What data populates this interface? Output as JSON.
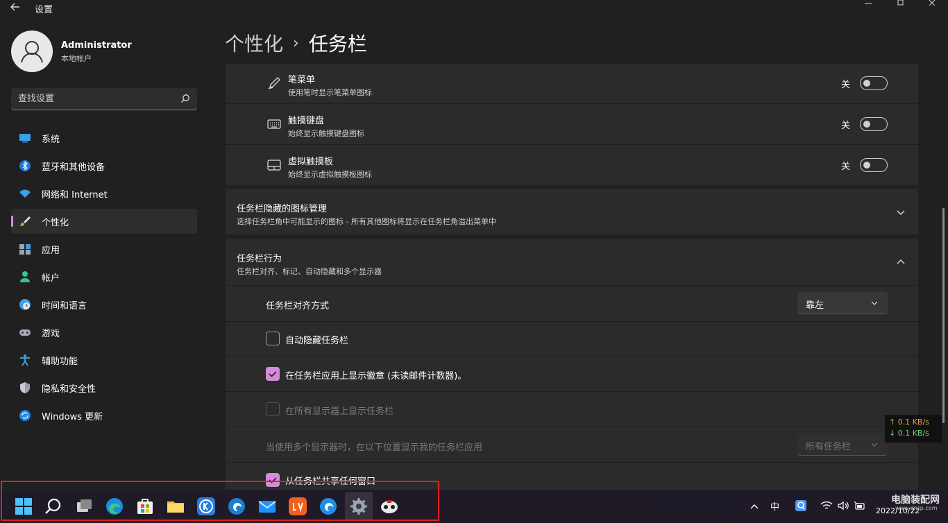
{
  "titlebar": {
    "back_icon": "arrow-left-icon",
    "title": "设置"
  },
  "user": {
    "name": "Administrator",
    "type": "本地帐户"
  },
  "search": {
    "placeholder": "查找设置"
  },
  "sidebar": {
    "items": [
      {
        "label": "系统",
        "icon": "monitor-icon",
        "active": false
      },
      {
        "label": "蓝牙和其他设备",
        "icon": "bluetooth-icon",
        "active": false
      },
      {
        "label": "网络和 Internet",
        "icon": "wifi-icon",
        "active": false
      },
      {
        "label": "个性化",
        "icon": "brush-icon",
        "active": true
      },
      {
        "label": "应用",
        "icon": "apps-icon",
        "active": false
      },
      {
        "label": "帐户",
        "icon": "person-icon",
        "active": false
      },
      {
        "label": "时间和语言",
        "icon": "clock-globe-icon",
        "active": false
      },
      {
        "label": "游戏",
        "icon": "gamepad-icon",
        "active": false
      },
      {
        "label": "辅助功能",
        "icon": "accessibility-icon",
        "active": false
      },
      {
        "label": "隐私和安全性",
        "icon": "shield-icon",
        "active": false
      },
      {
        "label": "Windows 更新",
        "icon": "update-icon",
        "active": false
      }
    ]
  },
  "breadcrumb": {
    "parent": "个性化",
    "separator": "›",
    "current": "任务栏"
  },
  "corner_icons": [
    {
      "title": "笔菜单",
      "sub": "使用笔时显示笔菜单图标",
      "state": "关",
      "icon": "pen-icon"
    },
    {
      "title": "触摸键盘",
      "sub": "始终显示触摸键盘图标",
      "state": "关",
      "icon": "keyboard-icon"
    },
    {
      "title": "虚拟触摸板",
      "sub": "始终显示虚拟触摸板图标",
      "state": "关",
      "icon": "touchpad-icon"
    }
  ],
  "overflow_section": {
    "title": "任务栏隐藏的图标管理",
    "sub": "选择任务栏角中可能显示的图标 - 所有其他图标将显示在任务栏角溢出菜单中"
  },
  "behavior_section": {
    "title": "任务栏行为",
    "sub": "任务栏对齐、标记、自动隐藏和多个显示器",
    "alignment_label": "任务栏对齐方式",
    "alignment_value": "靠左",
    "options": [
      {
        "label": "自动隐藏任务栏",
        "checked": false,
        "disabled": false
      },
      {
        "label": "在任务栏应用上显示徽章 (未读邮件计数器)。",
        "checked": true,
        "disabled": false
      },
      {
        "label": "在所有显示器上显示任务栏",
        "checked": false,
        "disabled": true
      }
    ],
    "multi_display_label": "当使用多个显示器时，在以下位置显示我的任务栏应用",
    "multi_display_value": "所有任务栏",
    "share_label": "从任务栏共享任何窗口"
  },
  "netspeed": {
    "up": "↑ 0.1 KB/s",
    "down": "↓ 0.1 KB/s"
  },
  "taskbar": {
    "tray_ime": "中",
    "clock": "2022/10/22",
    "watermark": "电脑装配网",
    "watermark_sub": "www.dnzp.com"
  },
  "colors": {
    "accent": "#d58bd8",
    "highlight_box": "#e02020"
  }
}
